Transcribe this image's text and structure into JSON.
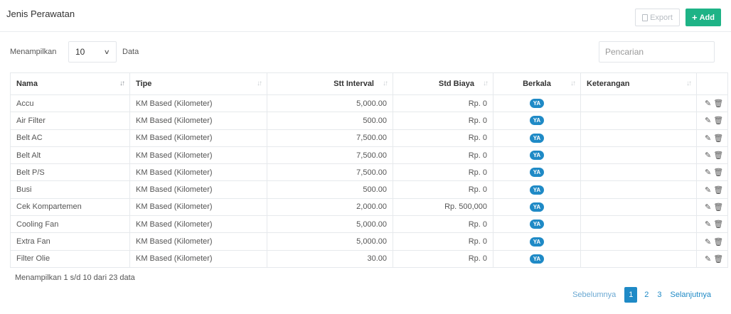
{
  "header": {
    "title": "Jenis Perawatan",
    "export_label": "Export",
    "add_label": "Add"
  },
  "controls": {
    "length_prefix": "Menampilkan",
    "length_value": "10",
    "length_suffix": "Data",
    "search_placeholder": "Pencarian"
  },
  "table": {
    "columns": [
      "Nama",
      "Tipe",
      "Stt Interval",
      "Std Biaya",
      "Berkala",
      "Keterangan",
      ""
    ],
    "rows": [
      {
        "nama": "Accu",
        "tipe": "KM Based (Kilometer)",
        "interval": "5,000.00",
        "biaya": "Rp. 0",
        "berkala": "YA",
        "keterangan": ""
      },
      {
        "nama": "Air Filter",
        "tipe": "KM Based (Kilometer)",
        "interval": "500.00",
        "biaya": "Rp. 0",
        "berkala": "YA",
        "keterangan": ""
      },
      {
        "nama": "Belt AC",
        "tipe": "KM Based (Kilometer)",
        "interval": "7,500.00",
        "biaya": "Rp. 0",
        "berkala": "YA",
        "keterangan": ""
      },
      {
        "nama": "Belt Alt",
        "tipe": "KM Based (Kilometer)",
        "interval": "7,500.00",
        "biaya": "Rp. 0",
        "berkala": "YA",
        "keterangan": ""
      },
      {
        "nama": "Belt P/S",
        "tipe": "KM Based (Kilometer)",
        "interval": "7,500.00",
        "biaya": "Rp. 0",
        "berkala": "YA",
        "keterangan": ""
      },
      {
        "nama": "Busi",
        "tipe": "KM Based (Kilometer)",
        "interval": "500.00",
        "biaya": "Rp. 0",
        "berkala": "YA",
        "keterangan": ""
      },
      {
        "nama": "Cek Kompartemen",
        "tipe": "KM Based (Kilometer)",
        "interval": "2,000.00",
        "biaya": "Rp. 500,000",
        "berkala": "YA",
        "keterangan": ""
      },
      {
        "nama": "Cooling Fan",
        "tipe": "KM Based (Kilometer)",
        "interval": "5,000.00",
        "biaya": "Rp. 0",
        "berkala": "YA",
        "keterangan": ""
      },
      {
        "nama": "Extra Fan",
        "tipe": "KM Based (Kilometer)",
        "interval": "5,000.00",
        "biaya": "Rp. 0",
        "berkala": "YA",
        "keterangan": ""
      },
      {
        "nama": "Filter Olie",
        "tipe": "KM Based (Kilometer)",
        "interval": "30.00",
        "biaya": "Rp. 0",
        "berkala": "YA",
        "keterangan": ""
      }
    ]
  },
  "footer": {
    "info": "Menampilkan 1 s/d 10 dari 23 data",
    "prev_label": "Sebelumnya",
    "pages": [
      "1",
      "2",
      "3"
    ],
    "next_label": "Selanjutnya"
  },
  "icons": {
    "edit": "edit-icon",
    "delete": "trash-icon",
    "export": "file-icon",
    "add": "plus-icon",
    "sort": "sort-icon"
  },
  "colors": {
    "primary": "#1f8ac6",
    "add_button": "#1eb386"
  }
}
